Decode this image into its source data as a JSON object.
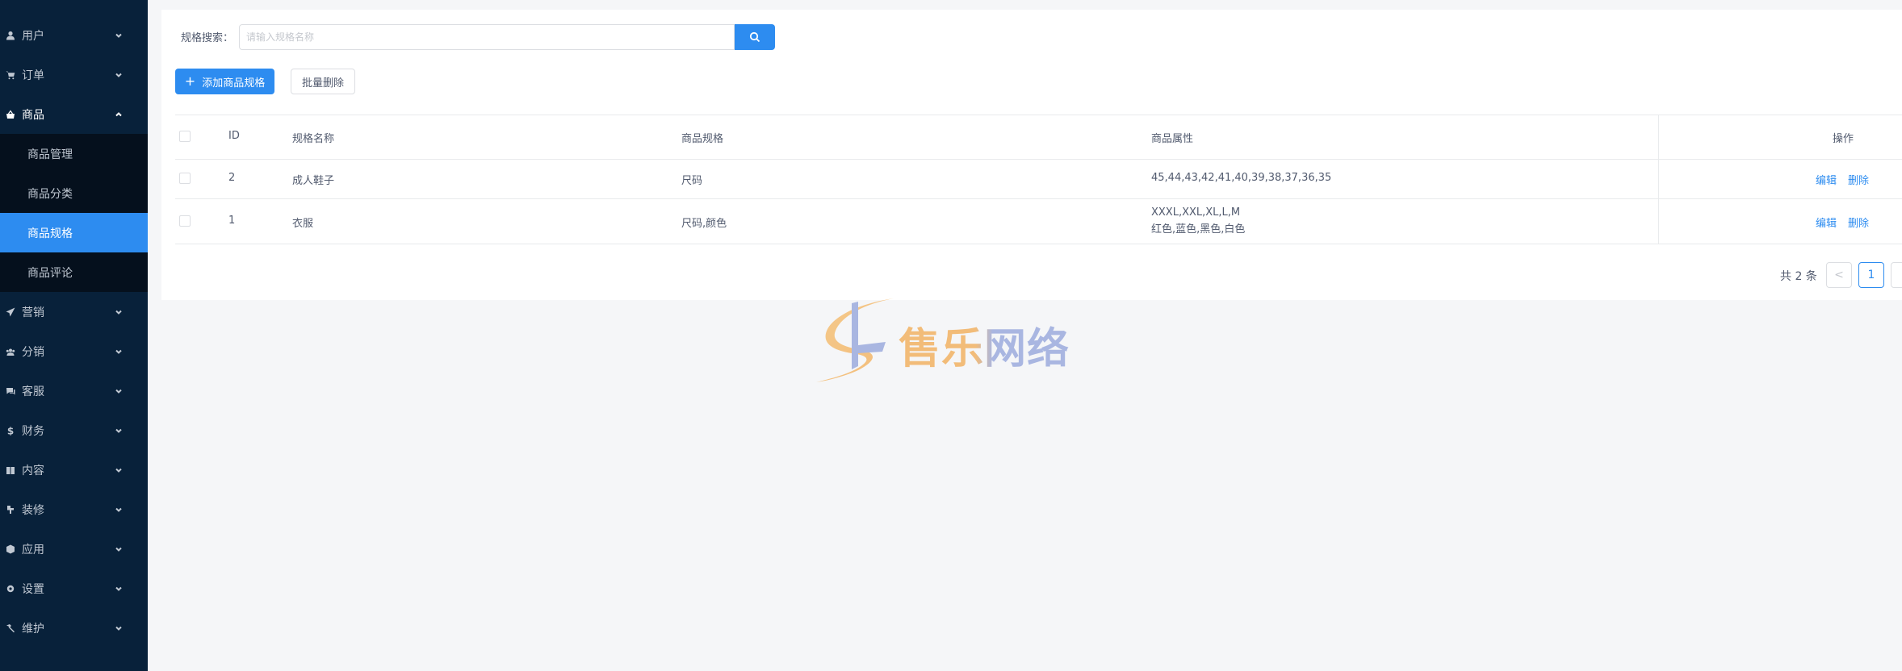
{
  "sidebar": {
    "items": [
      {
        "label": "用户",
        "icon": "user-icon"
      },
      {
        "label": "订单",
        "icon": "cart-icon"
      },
      {
        "label": "商品",
        "icon": "goods-icon"
      },
      {
        "label": "营销",
        "icon": "send-icon"
      },
      {
        "label": "分销",
        "icon": "team-icon"
      },
      {
        "label": "客服",
        "icon": "chat-icon"
      },
      {
        "label": "财务",
        "icon": "dollar-icon"
      },
      {
        "label": "内容",
        "icon": "book-icon"
      },
      {
        "label": "装修",
        "icon": "brush-icon"
      },
      {
        "label": "应用",
        "icon": "cube-icon"
      },
      {
        "label": "设置",
        "icon": "gear-icon"
      },
      {
        "label": "维护",
        "icon": "hammer-icon"
      }
    ],
    "submenu": [
      {
        "label": "商品管理"
      },
      {
        "label": "商品分类"
      },
      {
        "label": "商品规格",
        "active": true
      },
      {
        "label": "商品评论"
      }
    ],
    "active_color": "#2d8cf0"
  },
  "search": {
    "label": "规格搜索：",
    "placeholder": "请输入规格名称",
    "value": ""
  },
  "toolbar": {
    "add_label": "添加商品规格",
    "batch_delete_label": "批量删除"
  },
  "table": {
    "columns": [
      "ID",
      "规格名称",
      "商品规格",
      "商品属性",
      "操作"
    ],
    "rows": [
      {
        "id": "2",
        "name": "成人鞋子",
        "spec": "尺码",
        "attrs": [
          "45,44,43,42,41,40,39,38,37,36,35"
        ],
        "edit": "编辑",
        "delete": "删除"
      },
      {
        "id": "1",
        "name": "衣服",
        "spec": "尺码,颜色",
        "attrs": [
          "XXXL,XXL,XL,L,M",
          "红色,蓝色,黑色,白色"
        ],
        "edit": "编辑",
        "delete": "删除"
      }
    ]
  },
  "pagination": {
    "total_text": "共 2 条",
    "current_page": "1",
    "prev": "<"
  },
  "watermark": {
    "text": "售乐网络"
  },
  "colors": {
    "primary": "#2d8cf0",
    "sidebar_bg": "#08213a",
    "submenu_bg": "#05101d"
  }
}
